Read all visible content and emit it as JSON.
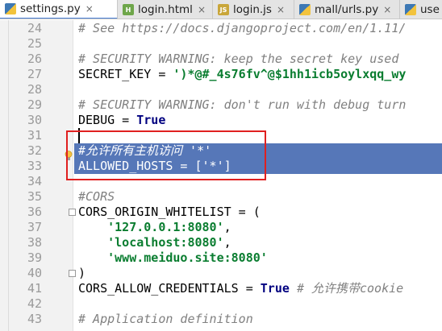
{
  "tabs": [
    {
      "label": "settings.py",
      "icon": "python-file-icon",
      "active": true
    },
    {
      "label": "login.html",
      "icon": "html-file-icon",
      "active": false
    },
    {
      "label": "login.js",
      "icon": "js-file-icon",
      "active": false
    },
    {
      "label": "mall/urls.py",
      "icon": "python-file-icon",
      "active": false
    },
    {
      "label": "use",
      "icon": "python-file-icon",
      "active": false
    }
  ],
  "lines": [
    {
      "n": "24",
      "parts": [
        [
          "c",
          "# See https://docs.djangoproject.com/en/1.11/"
        ]
      ]
    },
    {
      "n": "25",
      "parts": []
    },
    {
      "n": "26",
      "parts": [
        [
          "c",
          "# SECURITY WARNING: keep the secret key used"
        ]
      ]
    },
    {
      "n": "27",
      "parts": [
        [
          "p",
          "SECRET_KEY = "
        ],
        [
          "s",
          "')*@#_4s76fv^@$1hh1icb5oylxqq_wy"
        ]
      ]
    },
    {
      "n": "28",
      "parts": []
    },
    {
      "n": "29",
      "parts": [
        [
          "c",
          "# SECURITY WARNING: don't run with debug turn"
        ]
      ]
    },
    {
      "n": "30",
      "parts": [
        [
          "p",
          "DEBUG = "
        ],
        [
          "k",
          "True"
        ]
      ]
    },
    {
      "n": "31",
      "parts": []
    },
    {
      "n": "32",
      "parts": [
        [
          "c",
          "#允许所有主机访问 '*'"
        ]
      ],
      "selected": true
    },
    {
      "n": "33",
      "parts": [
        [
          "p",
          "ALLOWED_HOSTS = ['*']"
        ]
      ],
      "selected": true
    },
    {
      "n": "34",
      "parts": []
    },
    {
      "n": "35",
      "parts": [
        [
          "c",
          "#CORS"
        ]
      ]
    },
    {
      "n": "36",
      "parts": [
        [
          "p",
          "CORS_ORIGIN_WHITELIST = ("
        ]
      ]
    },
    {
      "n": "37",
      "parts": [
        [
          "p",
          "    "
        ],
        [
          "s",
          "'127.0.0.1:8080'"
        ],
        [
          "p",
          ","
        ]
      ]
    },
    {
      "n": "38",
      "parts": [
        [
          "p",
          "    "
        ],
        [
          "s",
          "'localhost:8080'"
        ],
        [
          "p",
          ","
        ]
      ]
    },
    {
      "n": "39",
      "parts": [
        [
          "p",
          "    "
        ],
        [
          "s",
          "'www.meiduo.site:8080'"
        ]
      ]
    },
    {
      "n": "40",
      "parts": [
        [
          "p",
          ")"
        ]
      ]
    },
    {
      "n": "41",
      "parts": [
        [
          "p",
          "CORS_ALLOW_CREDENTIALS = "
        ],
        [
          "k",
          "True"
        ],
        [
          "p",
          " "
        ],
        [
          "c",
          "# 允许携带cookie"
        ]
      ]
    },
    {
      "n": "42",
      "parts": []
    },
    {
      "n": "43",
      "parts": [
        [
          "c",
          "# Application definition"
        ]
      ]
    }
  ],
  "colors": {
    "selection": "#5677b8",
    "comment": "#808080",
    "string": "#0a7d30",
    "keyword": "#000080",
    "annotation_box": "#e02020"
  }
}
